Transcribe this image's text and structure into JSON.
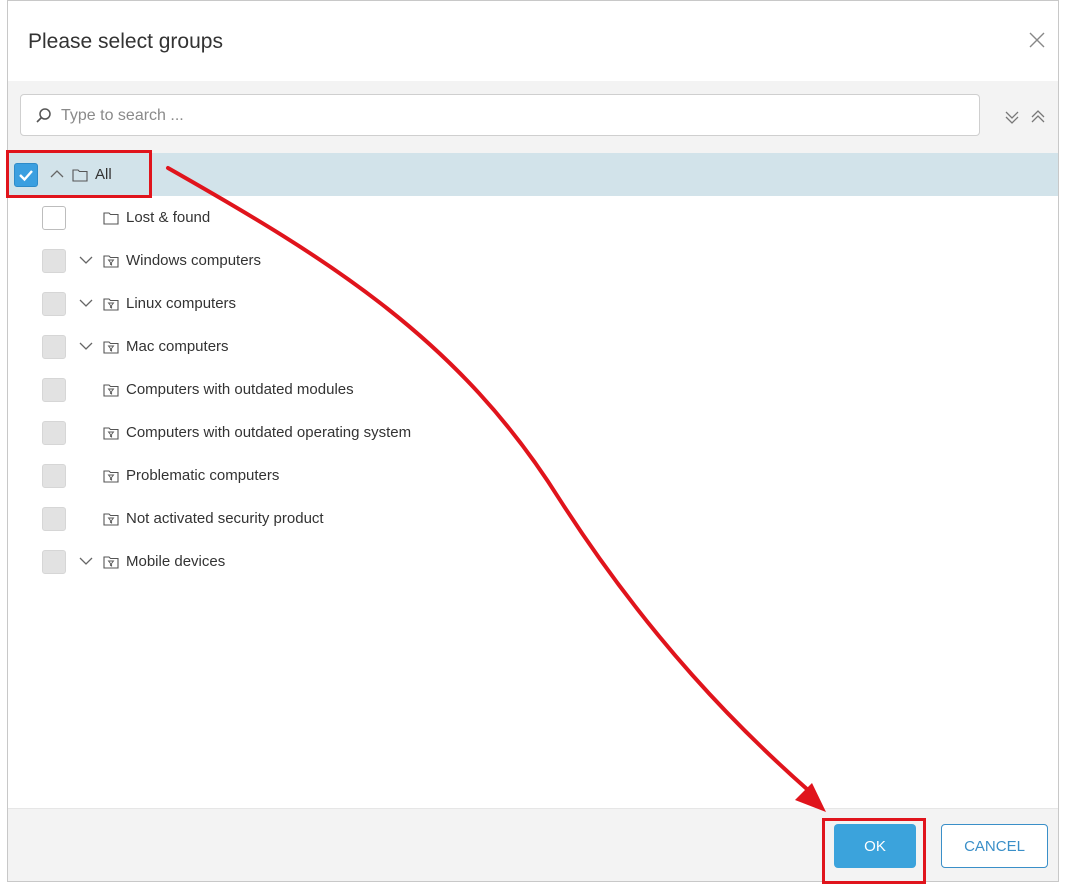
{
  "dialog": {
    "title": "Please select groups",
    "close_icon": "close-icon"
  },
  "search": {
    "placeholder": "Type to search ...",
    "value": "",
    "icon": "search-icon",
    "expand_all_icon": "double-chevron-down-icon",
    "collapse_all_icon": "double-chevron-up-icon"
  },
  "tree": {
    "items": [
      {
        "label": "All",
        "checked": true,
        "expander": "up",
        "icon": "folder-icon",
        "level": 0
      },
      {
        "label": "Lost & found",
        "checked": false,
        "expander": "none",
        "icon": "folder-icon",
        "level": 1
      },
      {
        "label": "Windows computers",
        "checked": false,
        "expander": "down",
        "icon": "dynamic-group-icon",
        "level": 1
      },
      {
        "label": "Linux computers",
        "checked": false,
        "expander": "down",
        "icon": "dynamic-group-icon",
        "level": 1
      },
      {
        "label": "Mac computers",
        "checked": false,
        "expander": "down",
        "icon": "dynamic-group-icon",
        "level": 1
      },
      {
        "label": "Computers with outdated modules",
        "checked": false,
        "expander": "none",
        "icon": "dynamic-group-icon",
        "level": 1
      },
      {
        "label": "Computers with outdated operating system",
        "checked": false,
        "expander": "none",
        "icon": "dynamic-group-icon",
        "level": 1
      },
      {
        "label": "Problematic computers",
        "checked": false,
        "expander": "none",
        "icon": "dynamic-group-icon",
        "level": 1
      },
      {
        "label": "Not activated security product",
        "checked": false,
        "expander": "none",
        "icon": "dynamic-group-icon",
        "level": 1
      },
      {
        "label": "Mobile devices",
        "checked": false,
        "expander": "down",
        "icon": "dynamic-group-icon",
        "level": 1
      }
    ]
  },
  "footer": {
    "ok_label": "OK",
    "cancel_label": "CANCEL"
  },
  "colors": {
    "accent": "#3ba3dc",
    "selected_row": "#d2e3ea",
    "annotation": "#e0141c"
  }
}
